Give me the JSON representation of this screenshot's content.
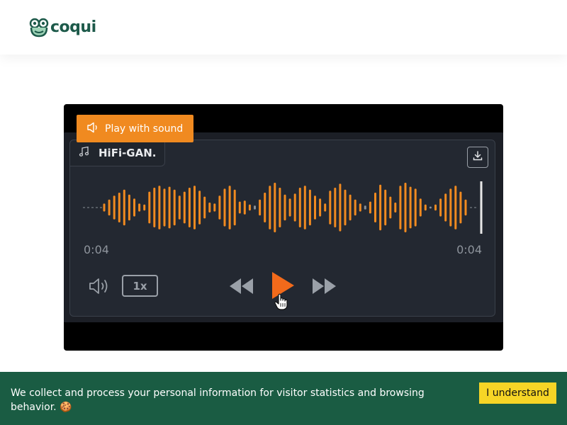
{
  "header": {
    "logo_text": "coqui",
    "logo_icon": "frog-icon"
  },
  "player": {
    "play_with_sound_label": "Play with sound",
    "model_label": "HiFi-GAN.",
    "current_time": "0:04",
    "duration": "0:04",
    "playback_rate": "1x",
    "playback_progress": 1.0,
    "accent_color": "#f08a20",
    "icons": {
      "speaker": "speaker-icon",
      "music_note": "music-note-icon",
      "download": "download-icon",
      "volume": "volume-icon",
      "rewind": "rewind-icon",
      "play": "play-icon",
      "forward": "fast-forward-icon",
      "cursor": "hand-cursor-icon"
    }
  },
  "cookie_banner": {
    "message": "We collect and process your personal information for visitor statistics and browsing behavior. 🍪",
    "accept_label": "I understand",
    "background_color": "#1a5c43",
    "button_color": "#f6d526"
  }
}
